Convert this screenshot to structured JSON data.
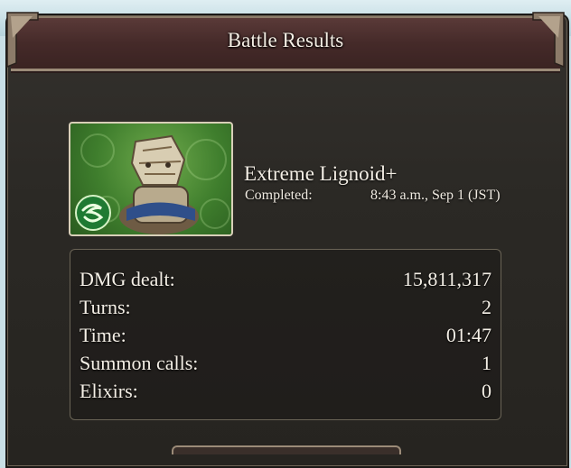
{
  "window": {
    "title": "Battle Results"
  },
  "battle": {
    "enemy_name": "Extreme Lignoid+",
    "completed_label": "Completed:",
    "completed_value": "8:43 a.m., Sep 1 (JST)",
    "element_icon": "wind-element-icon"
  },
  "stats": [
    {
      "label": "DMG dealt:",
      "value": "15,811,317"
    },
    {
      "label": "Turns:",
      "value": "2"
    },
    {
      "label": "Time:",
      "value": "01:47"
    },
    {
      "label": "Summon calls:",
      "value": "1"
    },
    {
      "label": "Elixirs:",
      "value": "0"
    }
  ],
  "colors": {
    "panel_bg": "#2b2925",
    "title_bar": "#452a29",
    "frame_trim": "#9b8b78",
    "text": "#f4efe6"
  }
}
